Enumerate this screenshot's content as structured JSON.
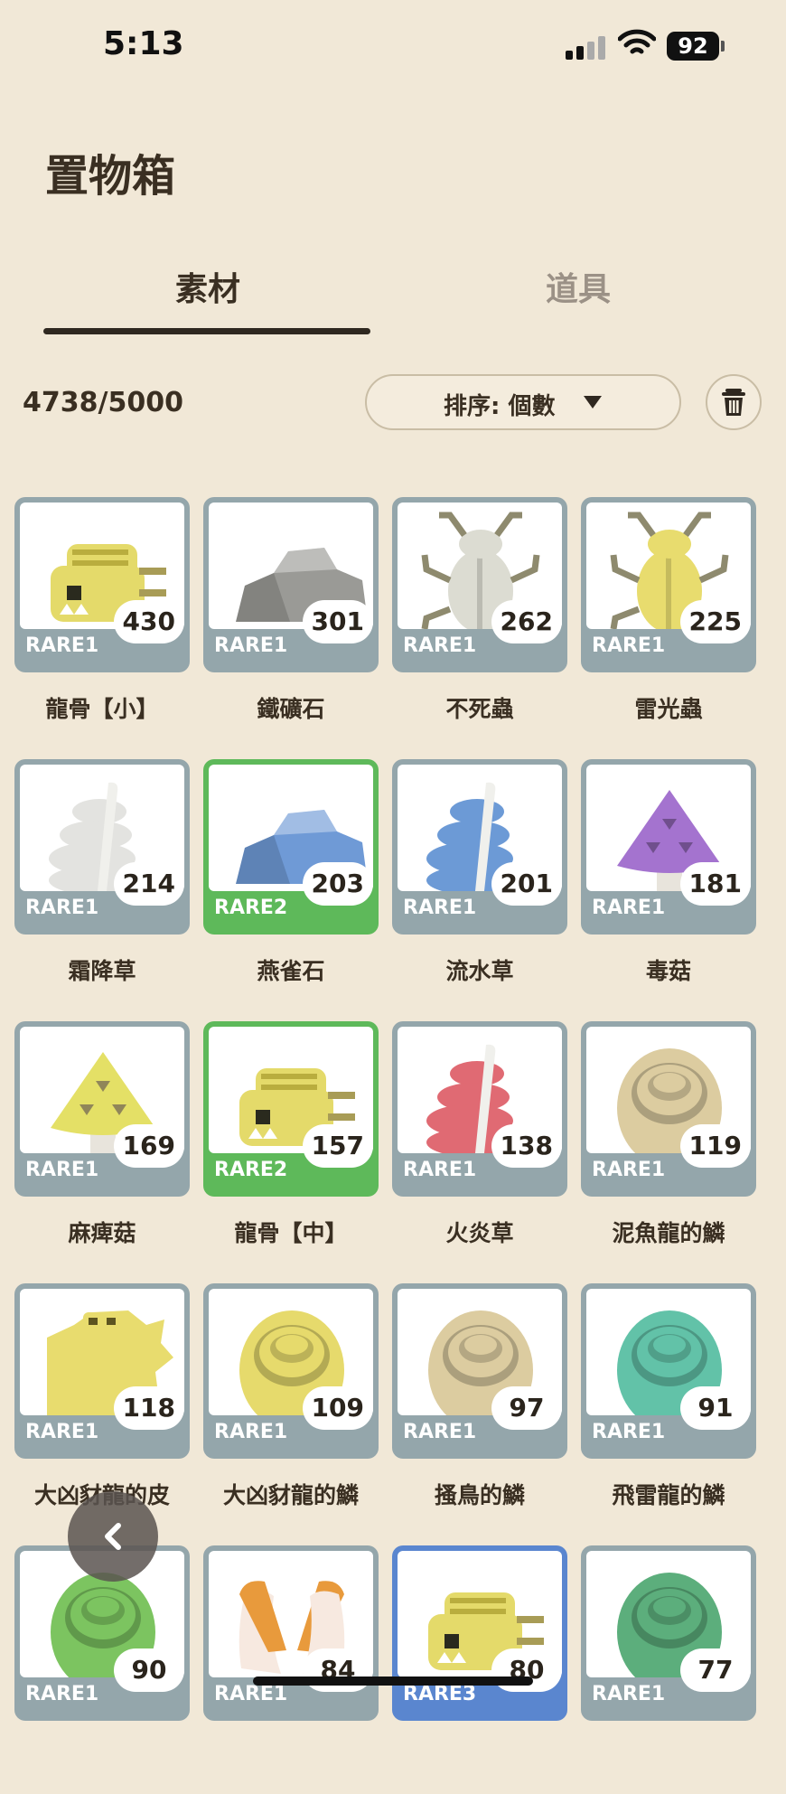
{
  "status_bar": {
    "time": "5:13",
    "battery": "92"
  },
  "page": {
    "title": "置物箱"
  },
  "tabs": [
    {
      "label": "素材",
      "active": true
    },
    {
      "label": "道具",
      "active": false
    }
  ],
  "toolbar": {
    "count": "4738/5000",
    "sort_label": "排序:  個數",
    "icons": {
      "sort": "triangle-down-icon",
      "trash": "trash-icon"
    }
  },
  "rarity_colors": {
    "RARE1": "#94a6ab",
    "RARE2": "#5eb95a",
    "RARE3": "#5a86cf"
  },
  "items": [
    {
      "name": "龍骨【小】",
      "qty": "430",
      "rarity": "RARE1",
      "icon": "skull-icon",
      "color": "#e4da6a"
    },
    {
      "name": "鐵礦石",
      "qty": "301",
      "rarity": "RARE1",
      "icon": "ore-icon",
      "color": "#9a9a96"
    },
    {
      "name": "不死蟲",
      "qty": "262",
      "rarity": "RARE1",
      "icon": "beetle-icon",
      "color": "#dcdcd2"
    },
    {
      "name": "雷光蟲",
      "qty": "225",
      "rarity": "RARE1",
      "icon": "beetle-icon",
      "color": "#e8dc6e"
    },
    {
      "name": "霜降草",
      "qty": "214",
      "rarity": "RARE1",
      "icon": "herb-icon",
      "color": "#e3e3e0"
    },
    {
      "name": "燕雀石",
      "qty": "203",
      "rarity": "RARE2",
      "icon": "ore-icon",
      "color": "#6f9ad6"
    },
    {
      "name": "流水草",
      "qty": "201",
      "rarity": "RARE1",
      "icon": "herb-icon",
      "color": "#6c9ad6"
    },
    {
      "name": "毒菇",
      "qty": "181",
      "rarity": "RARE1",
      "icon": "mushroom-icon",
      "color": "#a473cf"
    },
    {
      "name": "麻痺菇",
      "qty": "169",
      "rarity": "RARE1",
      "icon": "mushroom-icon",
      "color": "#e4e066"
    },
    {
      "name": "龍骨【中】",
      "qty": "157",
      "rarity": "RARE2",
      "icon": "skull-icon",
      "color": "#e4da6a"
    },
    {
      "name": "火炎草",
      "qty": "138",
      "rarity": "RARE1",
      "icon": "herb-icon",
      "color": "#e06a73"
    },
    {
      "name": "泥魚龍的鱗",
      "qty": "119",
      "rarity": "RARE1",
      "icon": "scale-icon",
      "color": "#dccca0"
    },
    {
      "name": "大凶豺龍的皮",
      "qty": "118",
      "rarity": "RARE1",
      "icon": "hide-icon",
      "color": "#e8dc6e"
    },
    {
      "name": "大凶豺龍的鱗",
      "qty": "109",
      "rarity": "RARE1",
      "icon": "scale-icon",
      "color": "#e6da6c"
    },
    {
      "name": "搔鳥的鱗",
      "qty": "97",
      "rarity": "RARE1",
      "icon": "scale-icon",
      "color": "#dccca0"
    },
    {
      "name": "飛雷龍的鱗",
      "qty": "91",
      "rarity": "RARE1",
      "icon": "scale-icon",
      "color": "#62c2a8"
    },
    {
      "name": "",
      "qty": "90",
      "rarity": "RARE1",
      "icon": "scale-icon",
      "color": "#7cc460"
    },
    {
      "name": "",
      "qty": "84",
      "rarity": "RARE1",
      "icon": "horn-icon",
      "color": "#e89a3c"
    },
    {
      "name": "",
      "qty": "80",
      "rarity": "RARE3",
      "icon": "skull-icon",
      "color": "#e4da6a"
    },
    {
      "name": "",
      "qty": "77",
      "rarity": "RARE1",
      "icon": "scale-icon",
      "color": "#5cae7c"
    }
  ],
  "overlay": {
    "back_icon": "chevron-left-icon"
  }
}
